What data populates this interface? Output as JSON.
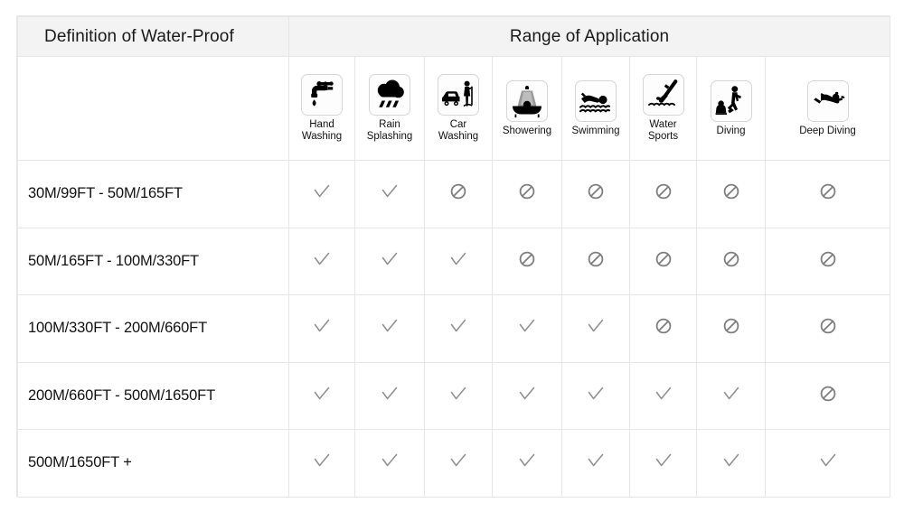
{
  "header": {
    "definition_title": "Definition of Water-Proof",
    "range_title": "Range of Application"
  },
  "colors": {
    "header_bg": "#f3f3f3",
    "grid_line": "#e6e6e6",
    "mark_gray": "#8e8e8e",
    "ban_gray": "#7e7e7e",
    "text": "#111111",
    "icon_fill": "#000000"
  },
  "columns": [
    {
      "icon": "faucet-hand-washing-icon",
      "label": "Hand\nWashing",
      "line1": "Hand",
      "line2": "Washing"
    },
    {
      "icon": "rain-cloud-icon",
      "label": "Rain\nSplashing",
      "line1": "Rain",
      "line2": "Splashing"
    },
    {
      "icon": "car-washing-icon",
      "label": "Car\nWashing",
      "line1": "Car",
      "line2": "Washing"
    },
    {
      "icon": "showering-icon",
      "label": "Showering",
      "line1": "Showering",
      "line2": ""
    },
    {
      "icon": "swimming-icon",
      "label": "Swimming",
      "line1": "Swimming",
      "line2": ""
    },
    {
      "icon": "water-sports-diver-icon",
      "label": "Water\nSports",
      "line1": "Water",
      "line2": "Sports"
    },
    {
      "icon": "diving-icon",
      "label": "Diving",
      "line1": "Diving",
      "line2": ""
    },
    {
      "icon": "deep-diving-scuba-icon",
      "label": "Deep Diving",
      "line1": "Deep Diving",
      "line2": ""
    }
  ],
  "rows": [
    {
      "range": "30M/99FT   -   50M/165FT",
      "marks": [
        "check",
        "check",
        "ban",
        "ban",
        "ban",
        "ban",
        "ban",
        "ban"
      ]
    },
    {
      "range": "50M/165FT   -   100M/330FT",
      "marks": [
        "check",
        "check",
        "check",
        "ban",
        "ban",
        "ban",
        "ban",
        "ban"
      ]
    },
    {
      "range": "100M/330FT   -   200M/660FT",
      "marks": [
        "check",
        "check",
        "check",
        "check",
        "check",
        "ban",
        "ban",
        "ban"
      ]
    },
    {
      "range": "200M/660FT   -   500M/1650FT",
      "marks": [
        "check",
        "check",
        "check",
        "check",
        "check",
        "check",
        "check",
        "ban"
      ]
    },
    {
      "range": "500M/1650FT   +",
      "marks": [
        "check",
        "check",
        "check",
        "check",
        "check",
        "check",
        "check",
        "check"
      ]
    }
  ]
}
